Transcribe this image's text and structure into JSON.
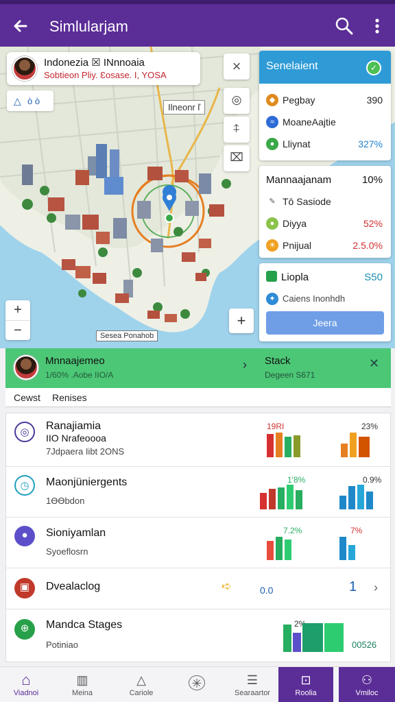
{
  "appbar": {
    "title": "Simlularjam",
    "back_icon": "arrow-left-icon",
    "search_icon": "search-icon",
    "more_icon": "more-vert-icon"
  },
  "map": {
    "info_card": {
      "line1": "Indonezia ☒ INnnoaia",
      "line2": "Sobtieon Pliy. Ɛosase. I, YOSA"
    },
    "chip": {
      "icon": "△",
      "text": "ò ò"
    },
    "close_label": "×",
    "place_label": "Ilneonr ľ",
    "tools": [
      "◎",
      "⍏",
      "⌧"
    ],
    "zoom_in": "+",
    "zoom_out": "−",
    "plus": "+",
    "scale_label": "Sesea Ponahob"
  },
  "panels": {
    "p1": {
      "title": "Senelaient",
      "rows": [
        {
          "name": "Pegbay",
          "value": "390",
          "color": "#e08a1e"
        },
        {
          "name": "MoaneAajtie",
          "value": "",
          "color": "#2e6bd6"
        },
        {
          "name": "Lliynat",
          "value": "327%",
          "color": "#3ba84a",
          "value_color": "#1a7fd0"
        }
      ]
    },
    "p2": {
      "title": "Mannaajanam",
      "title_value": "10%",
      "rows": [
        {
          "name": "Tō Sasiode",
          "value": "",
          "color": "#888"
        },
        {
          "name": "Diyya",
          "value": "52%",
          "color": "#8bc34a",
          "value_color": "#d03030"
        },
        {
          "name": "Pnijual",
          "value": "2.5.0%",
          "color": "#f0a020",
          "value_color": "#d03030"
        }
      ]
    },
    "p3": {
      "title": "Liopla",
      "title_value": "S50",
      "title_value_color": "#1a8fb0",
      "rows": [
        {
          "name": "Caiens Inonhdh",
          "value": "",
          "color": "#2e8bd6"
        }
      ],
      "button": "Jeera"
    }
  },
  "green_bar": {
    "name": "Mnnaajemeo",
    "sub": "1/60% .Aobe IIO/A",
    "status_title": "Stack",
    "status_sub": "Degeen S671"
  },
  "tabs": [
    "Cewst",
    "Renises"
  ],
  "list": [
    {
      "icon": "◎",
      "icon_color": "#4a3a9a",
      "title": "Ranajiamia",
      "line2": "IIO Nrafeoooa",
      "line3": "7Jdpaera Iibt 2ONS",
      "pct_a": "19RI",
      "pct_b": "23%",
      "pct_b_color": "#333",
      "bars_a": [
        0.9,
        1.0,
        0.75,
        0.85,
        0.7
      ],
      "bars_b": [
        0.6,
        1.0,
        0.9
      ]
    },
    {
      "icon": "◷",
      "icon_color": "#1e9fbd",
      "title": "Maonjüniergents",
      "line2": "1ƟƟbdon",
      "line3": "",
      "pct_a": "1'8%",
      "pct_b": "0.9%",
      "pct_b_color": "#333",
      "bars_a": [
        0.7,
        0.85,
        0.95,
        1.0,
        0.75
      ],
      "bars_b": [
        0.5,
        0.9,
        1.0,
        0.7
      ]
    },
    {
      "icon": "⬮",
      "icon_color": "#3d5fc4",
      "title": "Sioniyamlan",
      "line2": "Syoeflosrn",
      "line3": "",
      "pct_a": "7.2%",
      "pct_b": "7%",
      "pct_b_color": "#d03030",
      "bars_a": [
        0.8,
        1.0,
        0.9
      ],
      "bars_b": [
        1.0,
        0.7
      ]
    },
    {
      "icon": "▣",
      "icon_color": "#c0392b",
      "title": "Dvealaclog",
      "line2": "",
      "line3": "",
      "pct_a": "0.0",
      "pct_b": "1",
      "pct_b_color": "#1a5fb0",
      "bars_a": [],
      "bars_b": []
    },
    {
      "icon": "⊕",
      "icon_color": "#27a04a",
      "title": "Mandca Stages",
      "line2": "Potiniao",
      "line3": "",
      "pct_a": "2%",
      "pct_b": "00526",
      "pct_b_color": "#1a7f5a",
      "bars_a": [
        0.9,
        0.7,
        1.0,
        1.0,
        0.9
      ],
      "bars_b": []
    }
  ],
  "bottomnav": [
    {
      "label": "Viadnoi",
      "icon": "home-icon",
      "glyph": "⌂",
      "active": false
    },
    {
      "label": "Meina",
      "icon": "map-icon",
      "glyph": "▥",
      "active": false
    },
    {
      "label": "Cariole",
      "icon": "tent-icon",
      "glyph": "△",
      "active": false
    },
    {
      "label": "",
      "icon": "compass-icon",
      "glyph": "✳",
      "active": false
    },
    {
      "label": "Searaartor",
      "icon": "list-icon",
      "glyph": "☰",
      "active": false
    },
    {
      "label": "Roolia",
      "icon": "inbox-icon",
      "glyph": "⊡",
      "active": true
    },
    {
      "label": "Vmiloc",
      "icon": "user-icon",
      "glyph": "⚇",
      "active": true
    }
  ]
}
